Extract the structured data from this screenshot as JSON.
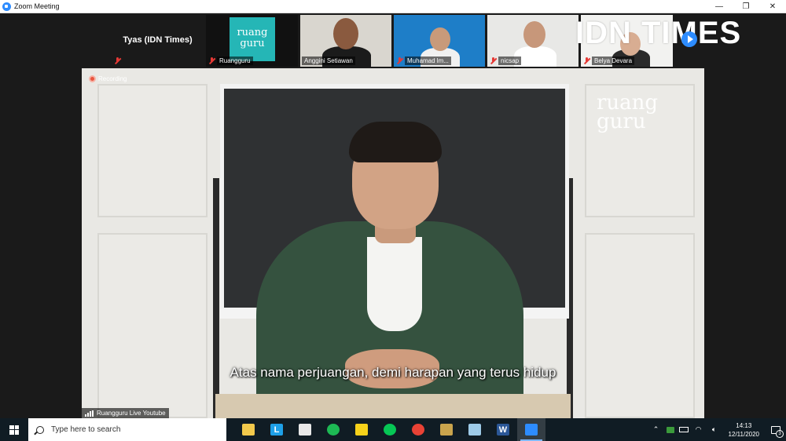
{
  "window": {
    "title": "Zoom Meeting",
    "minimize_glyph": "—",
    "maximize_glyph": "❐",
    "close_glyph": "✕"
  },
  "gallery": {
    "participants": [
      {
        "name": "Tyas (IDN Times)",
        "muted": true
      },
      {
        "name": "Ruangguru",
        "muted": true,
        "logo_line1": "ruang",
        "logo_line2": "guru"
      },
      {
        "name": "Anggini Setiawan",
        "muted": false
      },
      {
        "name": "Muhamad  lm...",
        "muted": true
      },
      {
        "name": "nicsap",
        "muted": true
      },
      {
        "name": "Belya Devara",
        "muted": true
      }
    ],
    "overlay_logo": "IDN TIMES",
    "next_page_icon": "chevron-right-icon"
  },
  "main_video": {
    "recording_label": "Recording",
    "watermark_line1": "ruang",
    "watermark_line2": "guru",
    "subtitle": "Atas nama perjuangan, demi harapan yang terus hidup",
    "speaker_label": "Ruangguru Live Youtube"
  },
  "taskbar": {
    "search_placeholder": "Type here to search",
    "apps": [
      {
        "name": "file-explorer-icon",
        "color": "#f2c94c"
      },
      {
        "name": "l-app-icon",
        "color": "#1ea0e8",
        "glyph": "L"
      },
      {
        "name": "store-icon",
        "color": "#e8e8e8"
      },
      {
        "name": "spotify-icon",
        "color": "#1db954"
      },
      {
        "name": "sticky-notes-icon",
        "color": "#f7d21a"
      },
      {
        "name": "line-icon",
        "color": "#06c755"
      },
      {
        "name": "chrome-icon",
        "color": "#e94235"
      },
      {
        "name": "paint-icon",
        "color": "#c9a44d"
      },
      {
        "name": "notepad-icon",
        "color": "#9ecbe8"
      },
      {
        "name": "word-icon",
        "color": "#2b5797",
        "glyph": "W"
      },
      {
        "name": "zoom-icon",
        "color": "#2d8cff",
        "active": true
      }
    ],
    "time": "14:13",
    "date": "12/11/2020",
    "notification_count": "3"
  },
  "colors": {
    "zoom_blue": "#2d8cff",
    "muted_red": "#e53935",
    "taskbar_bg": "#101c24"
  }
}
